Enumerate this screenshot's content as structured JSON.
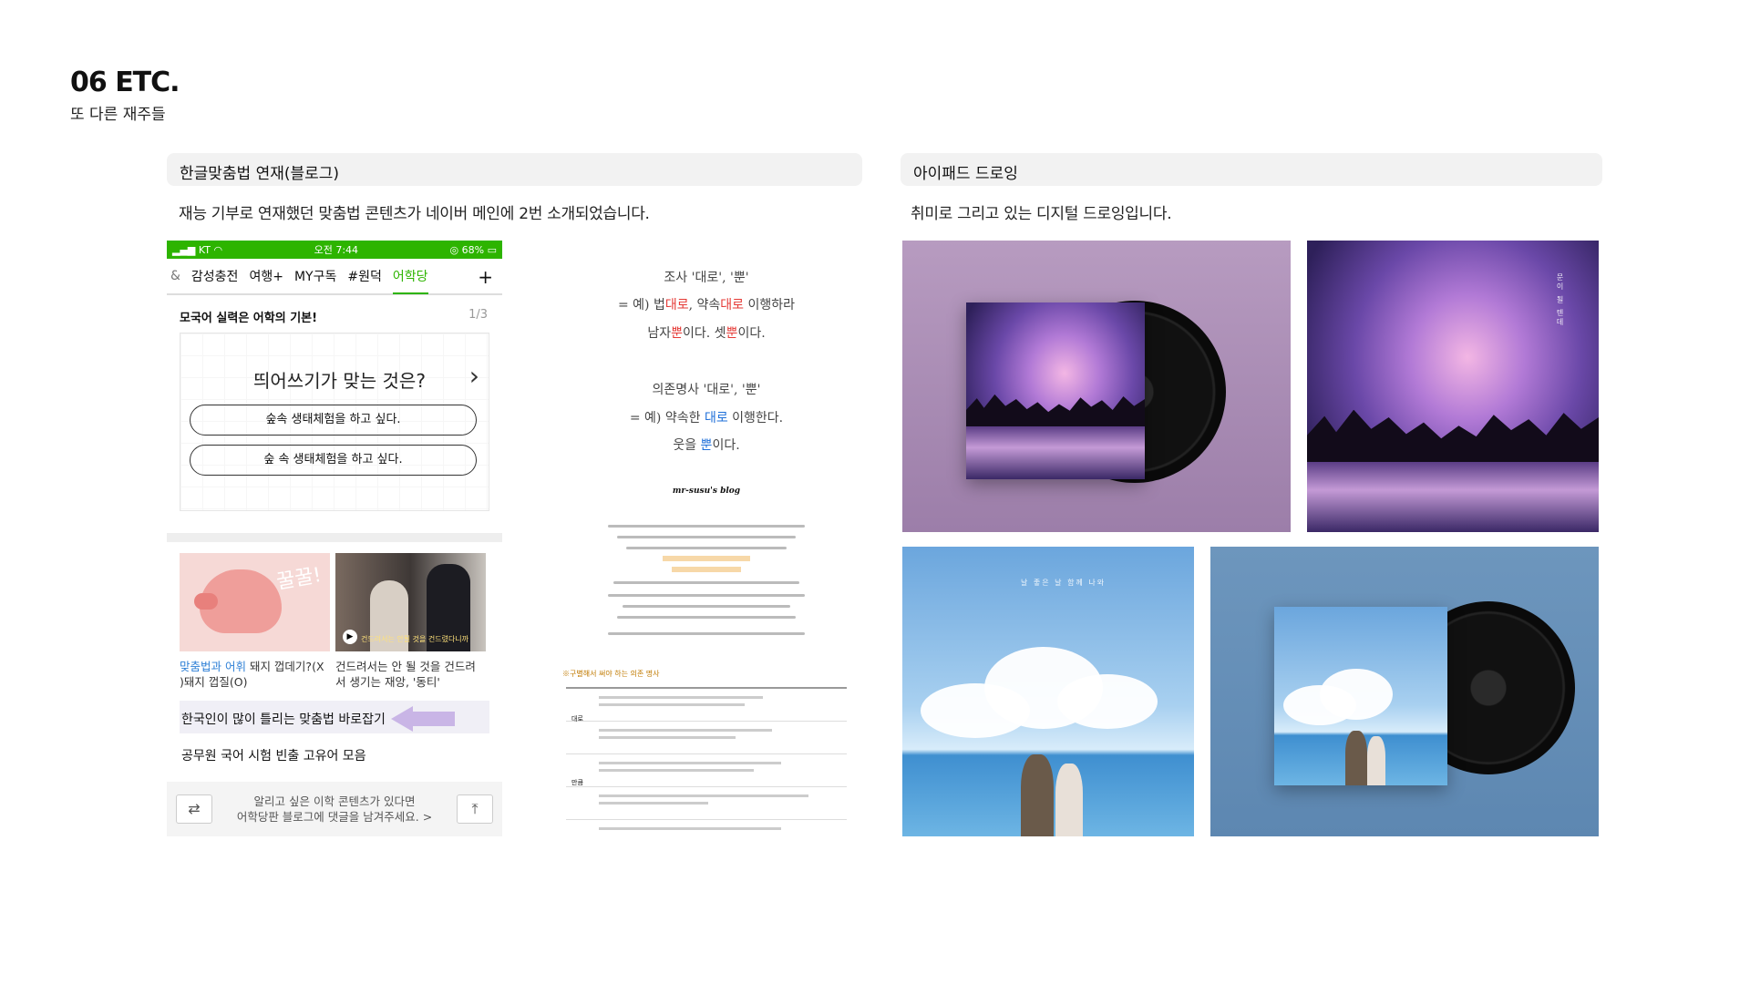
{
  "header": {
    "title": "06 ETC.",
    "subtitle": "또 다른 재주들"
  },
  "section_blog": {
    "heading": "한글맞춤법 연재(블로그)",
    "description": "재능 기부로 연재했던 맞춤법 콘텐츠가 네이버 메인에 2번 소개되었습니다."
  },
  "section_drawing": {
    "heading": "아이패드 드로잉",
    "description": "취미로 그리고 있는 디지털 드로잉입니다."
  },
  "phone": {
    "status": {
      "carrier": "KT",
      "time": "오전 7:44",
      "battery": "68%"
    },
    "tabs": [
      "&",
      "감성충전",
      "여행+",
      "MY구독",
      "#원덕",
      "어학당"
    ],
    "active_tab": "어학당",
    "plus": "+",
    "quiz_title": "모국어 실력은 어학의 기본!",
    "quiz_page": "1/3",
    "quiz_question": "띄어쓰기가 맞는 것은?",
    "option1": "숲속 생태체험을 하고 싶다.",
    "option2": "숲 속 생태체험을 하고 싶다.",
    "pig_text": "꿀꿀!",
    "drama_caption": "건드려서는 안될 것을 건드렸다니까",
    "card1_link": "맞춤법과 어휘",
    "card1_rest": " 돼지 껍데기?(X",
    "card1_line2": ")돼지 껍질(O)",
    "card2_line1": "건드려서는 안 될 것을 건드려",
    "card2_line2": "서 생기는 재앙, '동티'",
    "highlight": "한국인이 많이 틀리는 맞춤법 바로잡기",
    "item": "공무원 국어 시험 빈출 고유어 모음",
    "footer_line1": "알리고 싶은 이학 콘텐츠가 있다면",
    "footer_link": "어학당판 블로그",
    "footer_line2": "에 댓글을 남겨주세요.",
    "chevron": ">"
  },
  "blog": {
    "l1": "조사 '대로', '뿐'",
    "l2a": "= 예) 법",
    "l2b": "대로",
    "l2c": ", 약속",
    "l2d": "대로",
    "l2e": " 이행하라",
    "l3a": "남자",
    "l3b": "뿐",
    "l3c": "이다. 셋",
    "l3d": "뿐",
    "l3e": "이다.",
    "l4": "의존명사 '대로', '뿐'",
    "l5a": "= 예) 약속한 ",
    "l5b": "대로",
    "l5c": " 이행한다.",
    "l6a": "웃을 ",
    "l6b": "뿐",
    "l6c": "이다.",
    "signature": "mr-susu's blog",
    "table_heading": "※구별해서 써야 하는 의존 명사",
    "row1": "대로",
    "row2": "만큼"
  },
  "art": {
    "night_text": "문이 될 텐데",
    "sky_text": "날 좋은 날 함께 나와"
  }
}
